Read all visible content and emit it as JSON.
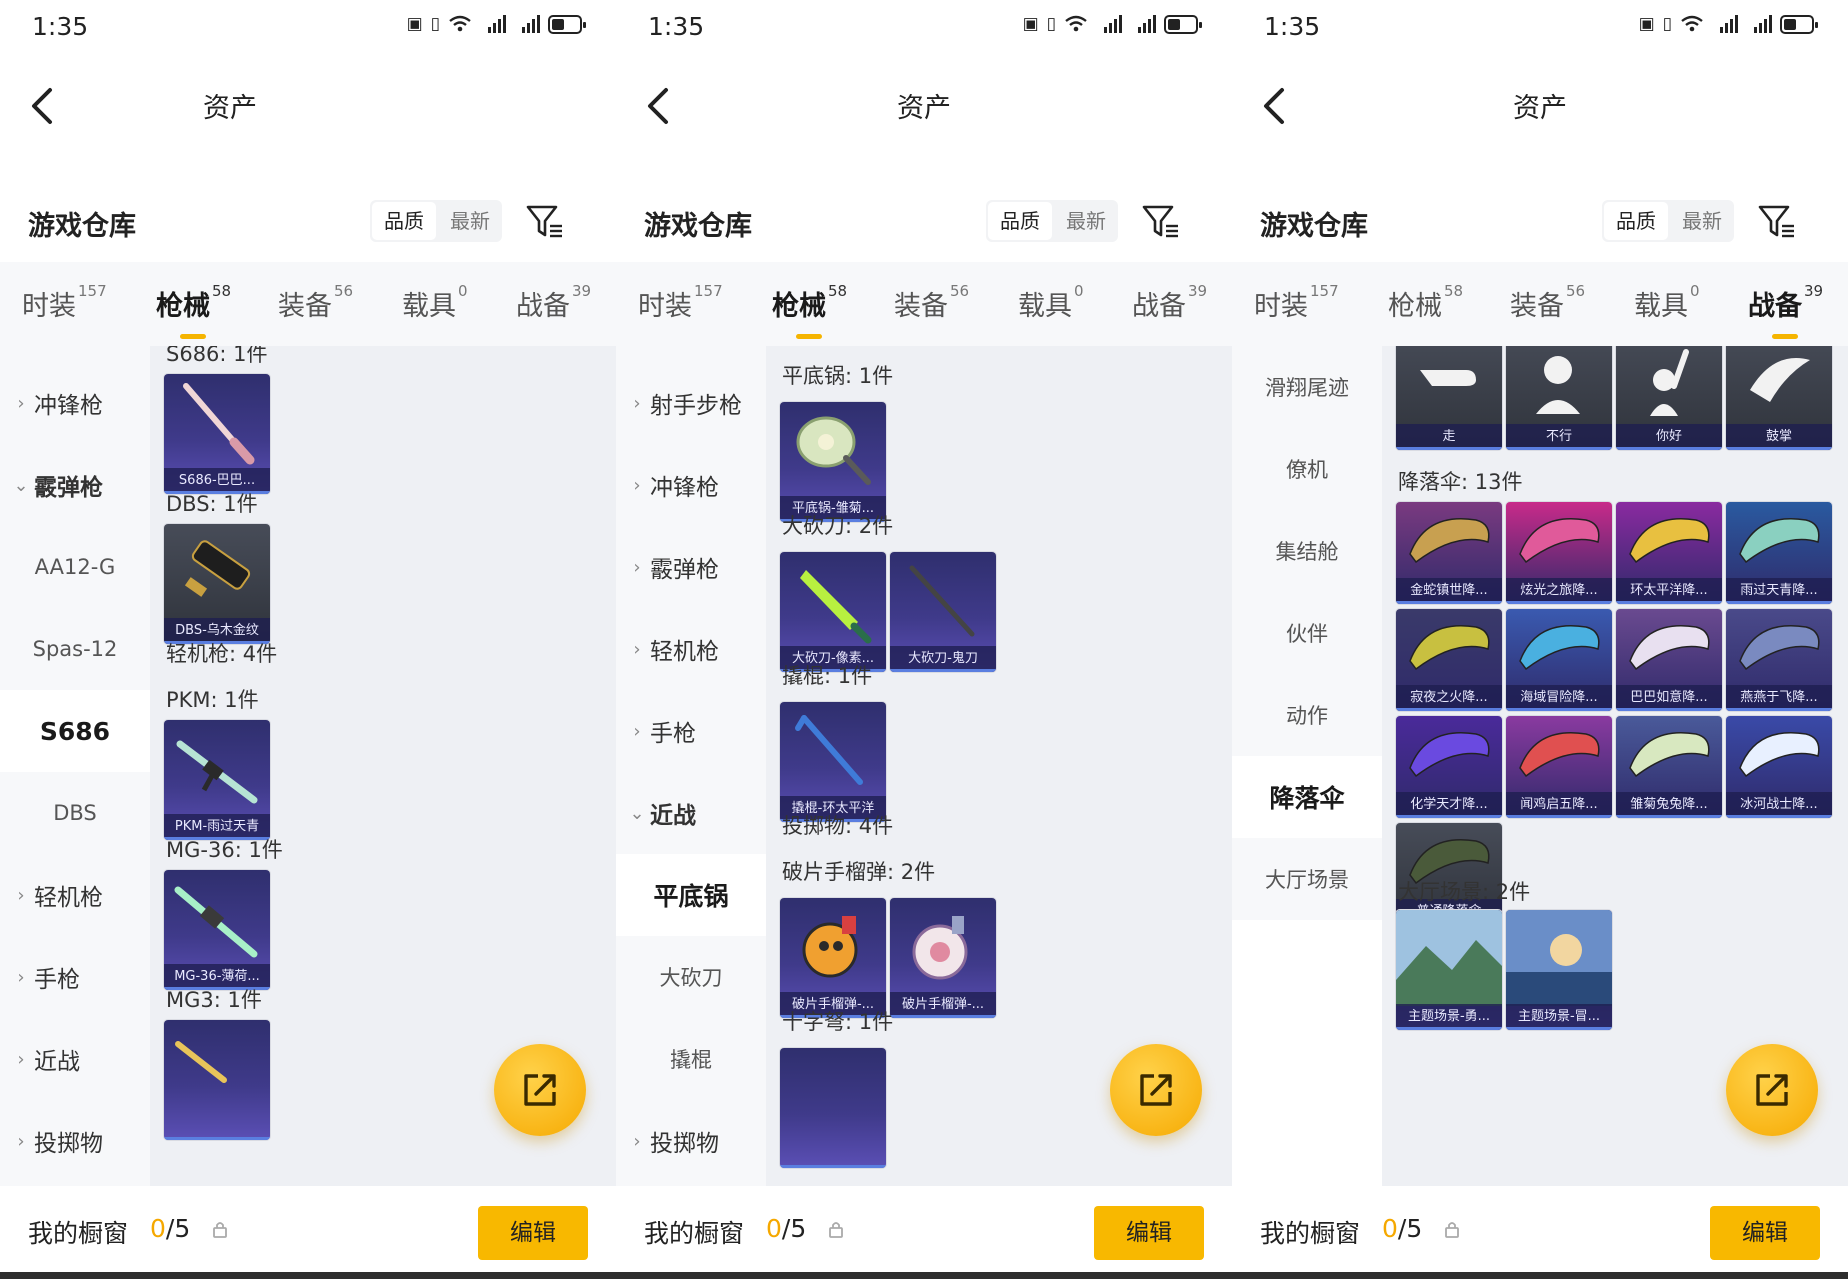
{
  "status": {
    "time": "1:35"
  },
  "nav": {
    "title": "资产"
  },
  "header": {
    "title": "游戏仓库",
    "sort_quality": "品质",
    "sort_latest": "最新"
  },
  "tabs": [
    {
      "label": "时装",
      "count": "157"
    },
    {
      "label": "枪械",
      "count": "58"
    },
    {
      "label": "装备",
      "count": "56"
    },
    {
      "label": "载具",
      "count": "0"
    },
    {
      "label": "战备",
      "count": "39"
    }
  ],
  "bottom": {
    "label": "我的橱窗",
    "count_current": "0",
    "count_total": "/5",
    "edit": "编辑"
  },
  "panel1": {
    "sidebar": [
      "冲锋枪",
      "霰弹枪",
      "AA12-G",
      "Spas-12",
      "S686",
      "DBS",
      "轻机枪",
      "手枪",
      "近战",
      "投掷物"
    ],
    "sections": {
      "s686": "S686: 1件",
      "dbs": "DBS: 1件",
      "lmg": "轻机枪: 4件",
      "pkm": "PKM: 1件",
      "mg36": "MG-36: 1件",
      "mg3": "MG3: 1件"
    },
    "items": [
      "S686-巴巴...",
      "DBS-乌木金纹",
      "PKM-雨过天青",
      "MG-36-薄荷..."
    ]
  },
  "panel2": {
    "sidebar": [
      "射手步枪",
      "冲锋枪",
      "霰弹枪",
      "轻机枪",
      "手枪",
      "近战",
      "平底锅",
      "大砍刀",
      "撬棍",
      "投掷物"
    ],
    "sections": {
      "pan": "平底锅: 1件",
      "machete": "大砍刀: 2件",
      "crowbar": "撬棍: 1件",
      "throw": "投掷物: 4件",
      "grenade": "破片手榴弹: 2件",
      "crossbow": "十字弩: 1件"
    },
    "items": [
      "平底锅-雏菊...",
      "大砍刀-像素...",
      "大砍刀-鬼刀",
      "撬棍-环太平洋",
      "破片手榴弹-...",
      "破片手榴弹-..."
    ]
  },
  "panel3": {
    "sidebar": [
      "滑翔尾迹",
      "僚机",
      "集结舱",
      "伙伴",
      "动作",
      "降落伞",
      "大厅场景"
    ],
    "emotes": [
      "走",
      "不行",
      "你好",
      "鼓掌"
    ],
    "sections": {
      "parachute": "降落伞: 13件",
      "lobby": "大厅场景: 2件"
    },
    "parachutes": [
      "金蛇镇世降...",
      "炫光之旅降...",
      "环太平洋降...",
      "雨过天青降...",
      "寂夜之火降...",
      "海域冒险降...",
      "巴巴如意降...",
      "燕燕于飞降...",
      "化学天才降...",
      "闻鸡启五降...",
      "雏菊兔兔降...",
      "冰河战士降...",
      "普通降落伞"
    ],
    "lobby": [
      "主题场景-勇...",
      "主题场景-冒..."
    ]
  }
}
